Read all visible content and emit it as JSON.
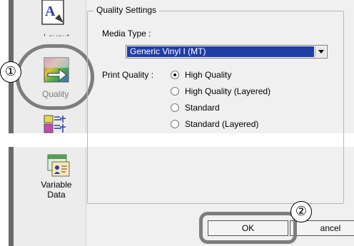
{
  "window": {
    "group_title": "Quality Settings"
  },
  "media": {
    "label": "Media Type :",
    "selected": "Generic Vinyl I (MT)"
  },
  "print_quality": {
    "label": "Print Quality :",
    "options": [
      {
        "label": "High Quality",
        "checked": true
      },
      {
        "label": "High Quality (Layered)",
        "checked": false
      },
      {
        "label": "Standard",
        "checked": false
      },
      {
        "label": "Standard (Layered)",
        "checked": false
      }
    ]
  },
  "sidebar": {
    "items": [
      {
        "label": "Layout",
        "icon": "layout-icon"
      },
      {
        "label": "Quality",
        "icon": "quality-icon"
      },
      {
        "label": "",
        "icon": "color-chart-icon"
      },
      {
        "label": "Variable Data",
        "icon": "variable-data-icon"
      }
    ],
    "variable_data_line1": "Variable",
    "variable_data_line2": "Data"
  },
  "buttons": {
    "ok": "OK",
    "cancel_partial": "ancel"
  },
  "callouts": {
    "first": "①",
    "second": "②"
  },
  "colors": {
    "selection_bg": "#1f3ea5",
    "highlight_ring": "#7d7d7d",
    "dialog_bg": "#f0f0f0"
  }
}
